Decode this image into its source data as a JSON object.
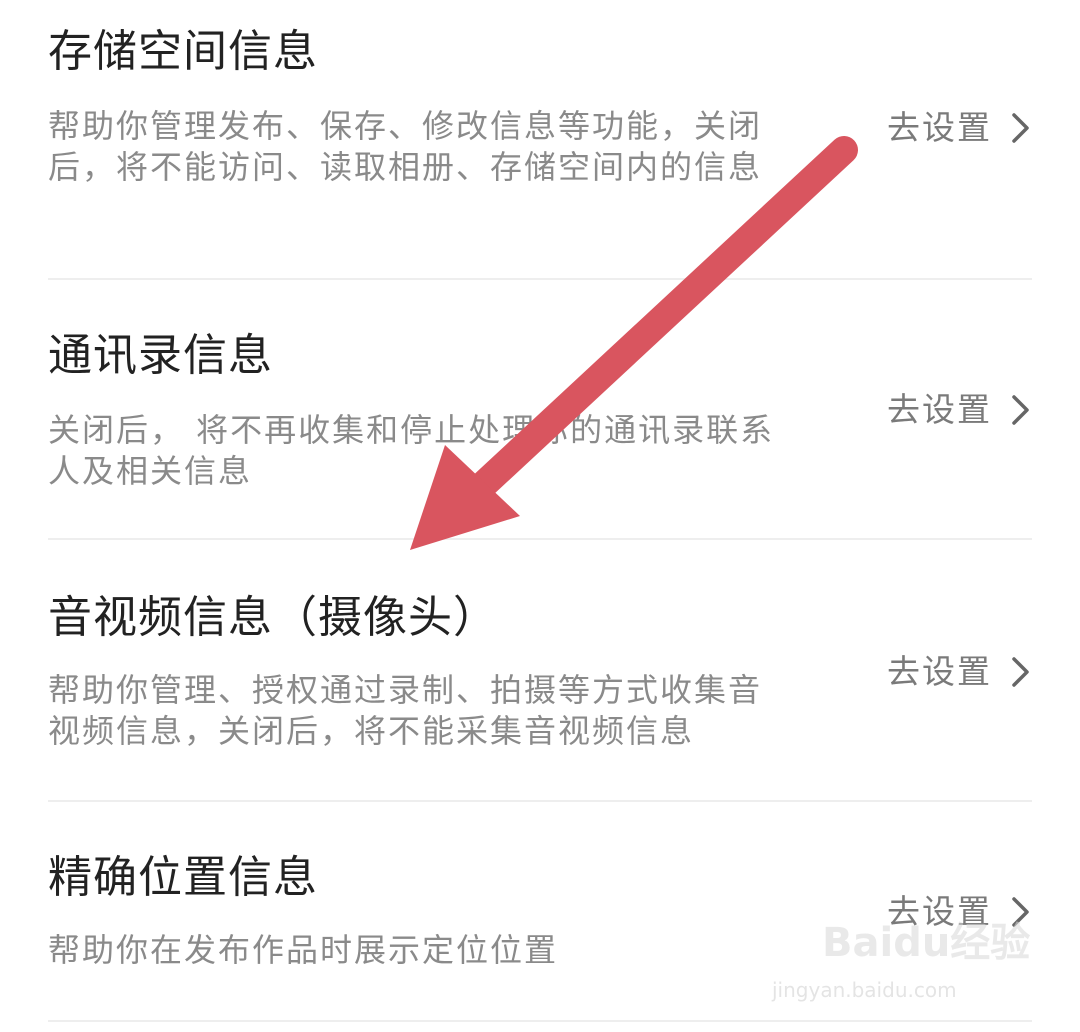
{
  "items": [
    {
      "title": "存储空间信息",
      "description": "帮助你管理发布、保存、修改信息等功能，关闭后，将不能访问、读取相册、存储空间内的信息",
      "action": "去设置"
    },
    {
      "title": "通讯录信息",
      "description": "关闭后， 将不再收集和停止处理你的通讯录联系人及相关信息",
      "action": "去设置"
    },
    {
      "title": "音视频信息（摄像头）",
      "description": "帮助你管理、授权通过录制、拍摄等方式收集音视频信息，关闭后，将不能采集音视频信息",
      "action": "去设置"
    },
    {
      "title": "精确位置信息",
      "description": "帮助你在发布作品时展示定位位置",
      "action": "去设置"
    }
  ],
  "watermark": {
    "brand": "Baidu经验",
    "url": "jingyan.baidu.com"
  },
  "colors": {
    "arrow": "#d9555f",
    "title": "#222222",
    "description": "#8a8a8a",
    "divider": "#eeeeee"
  }
}
